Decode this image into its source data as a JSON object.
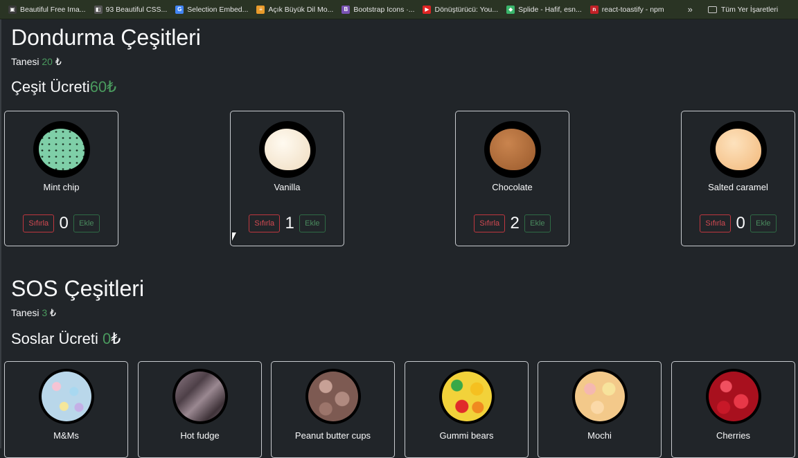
{
  "bookmarks": [
    {
      "label": "Beautiful Free Ima...",
      "icon": "camera-icon",
      "color": "#3a3a3a"
    },
    {
      "label": "93 Beautiful CSS...",
      "icon": "css-icon",
      "color": "#555555"
    },
    {
      "label": "Selection Embed...",
      "icon": "google-icon",
      "color": "#4285f4"
    },
    {
      "label": "Açık Büyük Dil Mo...",
      "icon": "layers-icon",
      "color": "#e89b2b"
    },
    {
      "label": "Bootstrap Icons ·...",
      "icon": "bootstrap-icon",
      "color": "#7952b3"
    },
    {
      "label": "Dönüştürücü: You...",
      "icon": "youtube-icon",
      "color": "#e02424"
    },
    {
      "label": "Splide - Hafif, esn...",
      "icon": "splide-icon",
      "color": "#3ab56b"
    },
    {
      "label": "react-toastify - npm",
      "icon": "npm-icon",
      "color": "#c12127"
    }
  ],
  "bookmarks_more": "»",
  "bookmarks_folder": "Tüm Yer İşaretleri",
  "flavors_section": {
    "title": "Dondurma Çeşitleri",
    "unit_label": "Tanesi",
    "unit_price": "20",
    "currency": "₺",
    "total_label": "Çeşit Ücreti",
    "total_value": "60",
    "total_currency": "₺",
    "items": [
      {
        "name": "Mint chip",
        "count": "0",
        "color": "#7fcfa8"
      },
      {
        "name": "Vanilla",
        "count": "1",
        "color": "#f5ead8"
      },
      {
        "name": "Chocolate",
        "count": "2",
        "color": "#b86f3a"
      },
      {
        "name": "Salted caramel",
        "count": "0",
        "color": "#f7cb93"
      }
    ],
    "reset_label": "Sıfırla",
    "add_label": "Ekle"
  },
  "toppings_section": {
    "title": "SOS Çeşitleri",
    "unit_label": "Tanesi",
    "unit_price": "3",
    "currency": "₺",
    "total_label": "Soslar Ücreti",
    "total_value": "0",
    "total_currency": "₺",
    "items": [
      {
        "name": "M&Ms",
        "color": "#c9d8e6"
      },
      {
        "name": "Hot fudge",
        "color": "#6b5a62"
      },
      {
        "name": "Peanut butter cups",
        "color": "#a07a70"
      },
      {
        "name": "Gummi bears",
        "color": "#e8b030"
      },
      {
        "name": "Mochi",
        "color": "#f0d9a0"
      },
      {
        "name": "Cherries",
        "color": "#d0202e"
      }
    ]
  }
}
